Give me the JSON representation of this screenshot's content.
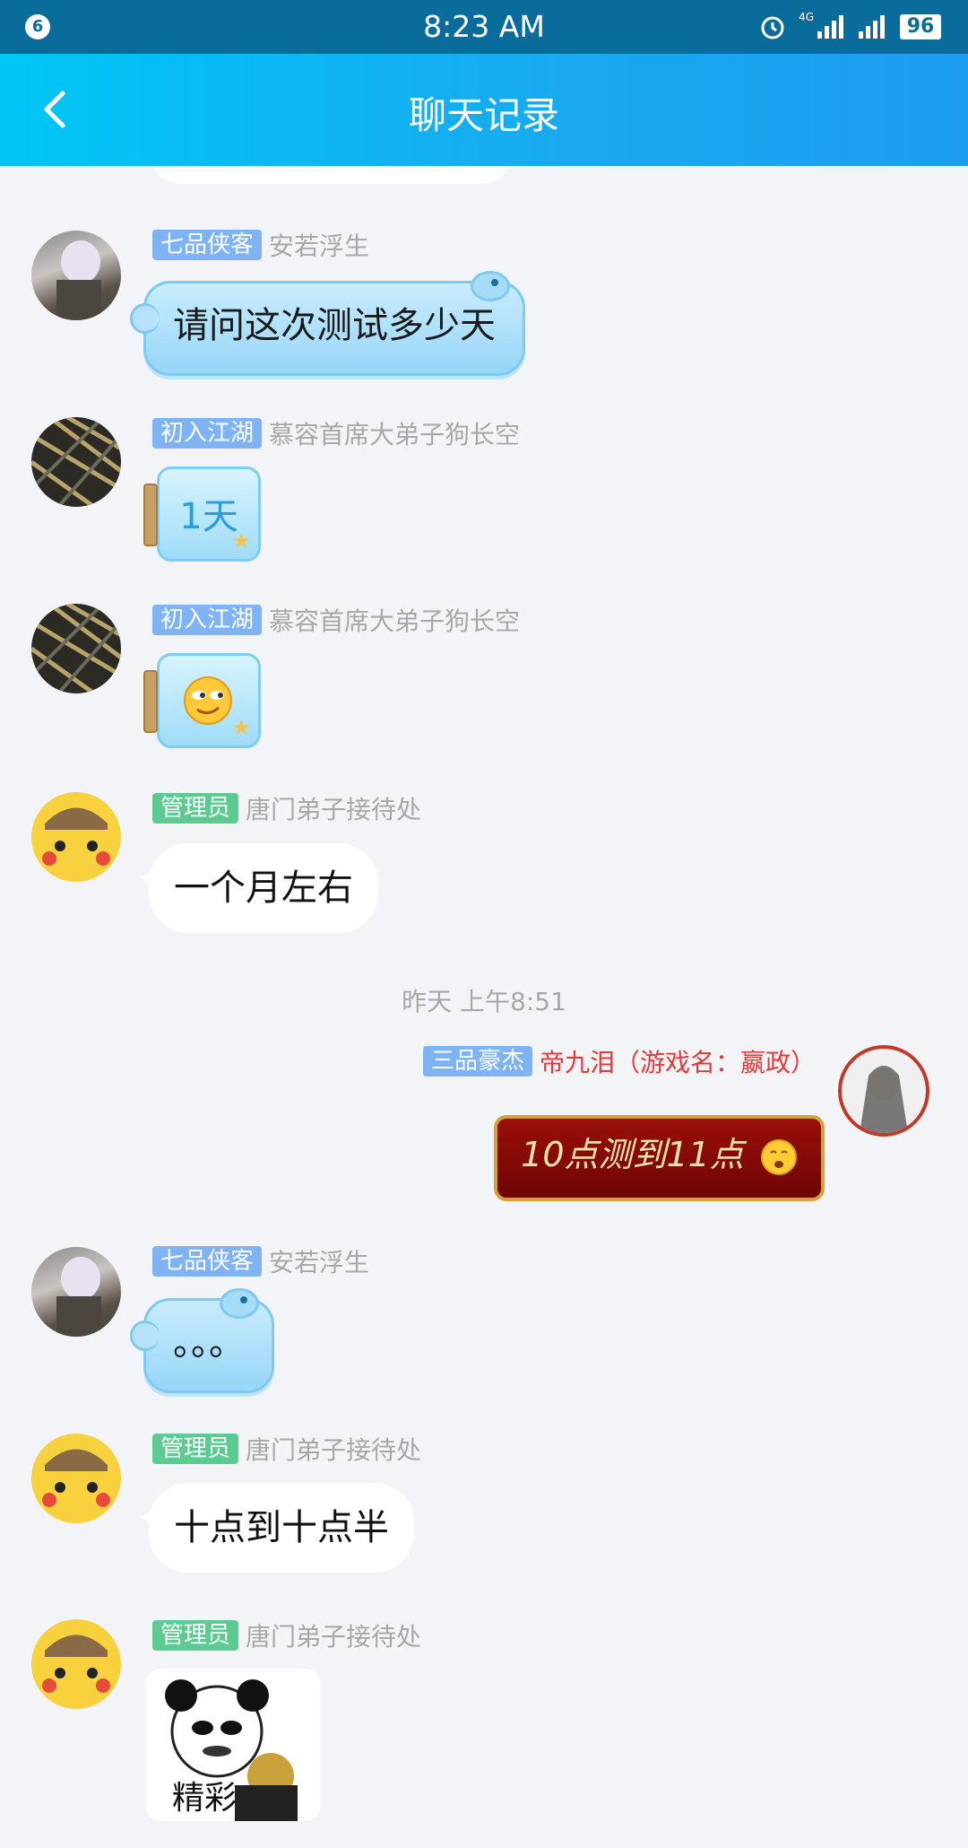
{
  "status": {
    "time": "8:23 AM",
    "badge": "6",
    "battery": "96",
    "network": "4G"
  },
  "header": {
    "title": "聊天记录"
  },
  "messages": [
    {
      "tag": "七品侠客",
      "nick": "安若浮生",
      "text": "请问这次测试多少天"
    },
    {
      "tag": "初入江湖",
      "nick": "慕容首席大弟子狗长空",
      "text": "1天"
    },
    {
      "tag": "初入江湖",
      "nick": "慕容首席大弟子狗长空"
    },
    {
      "tag": "管理员",
      "nick": "唐门弟子接待处",
      "text": "一个月左右"
    },
    {
      "timestamp": "昨天 上午8:51"
    },
    {
      "tag": "三品豪杰",
      "nick": "帝九泪（游戏名：嬴政）",
      "text": "10点测到11点"
    },
    {
      "tag": "七品侠客",
      "nick": "安若浮生",
      "text": "。。。"
    },
    {
      "tag": "管理员",
      "nick": "唐门弟子接待处",
      "text": "十点到十点半"
    },
    {
      "tag": "管理员",
      "nick": "唐门弟子接待处",
      "sticker_text": "精彩"
    }
  ],
  "colors": {
    "header": "#1aa8ef",
    "status": "#0a6c9a",
    "tag_blue": "#7eb4f6",
    "tag_green": "#5ccb92",
    "red_nick": "#e33a3a"
  }
}
